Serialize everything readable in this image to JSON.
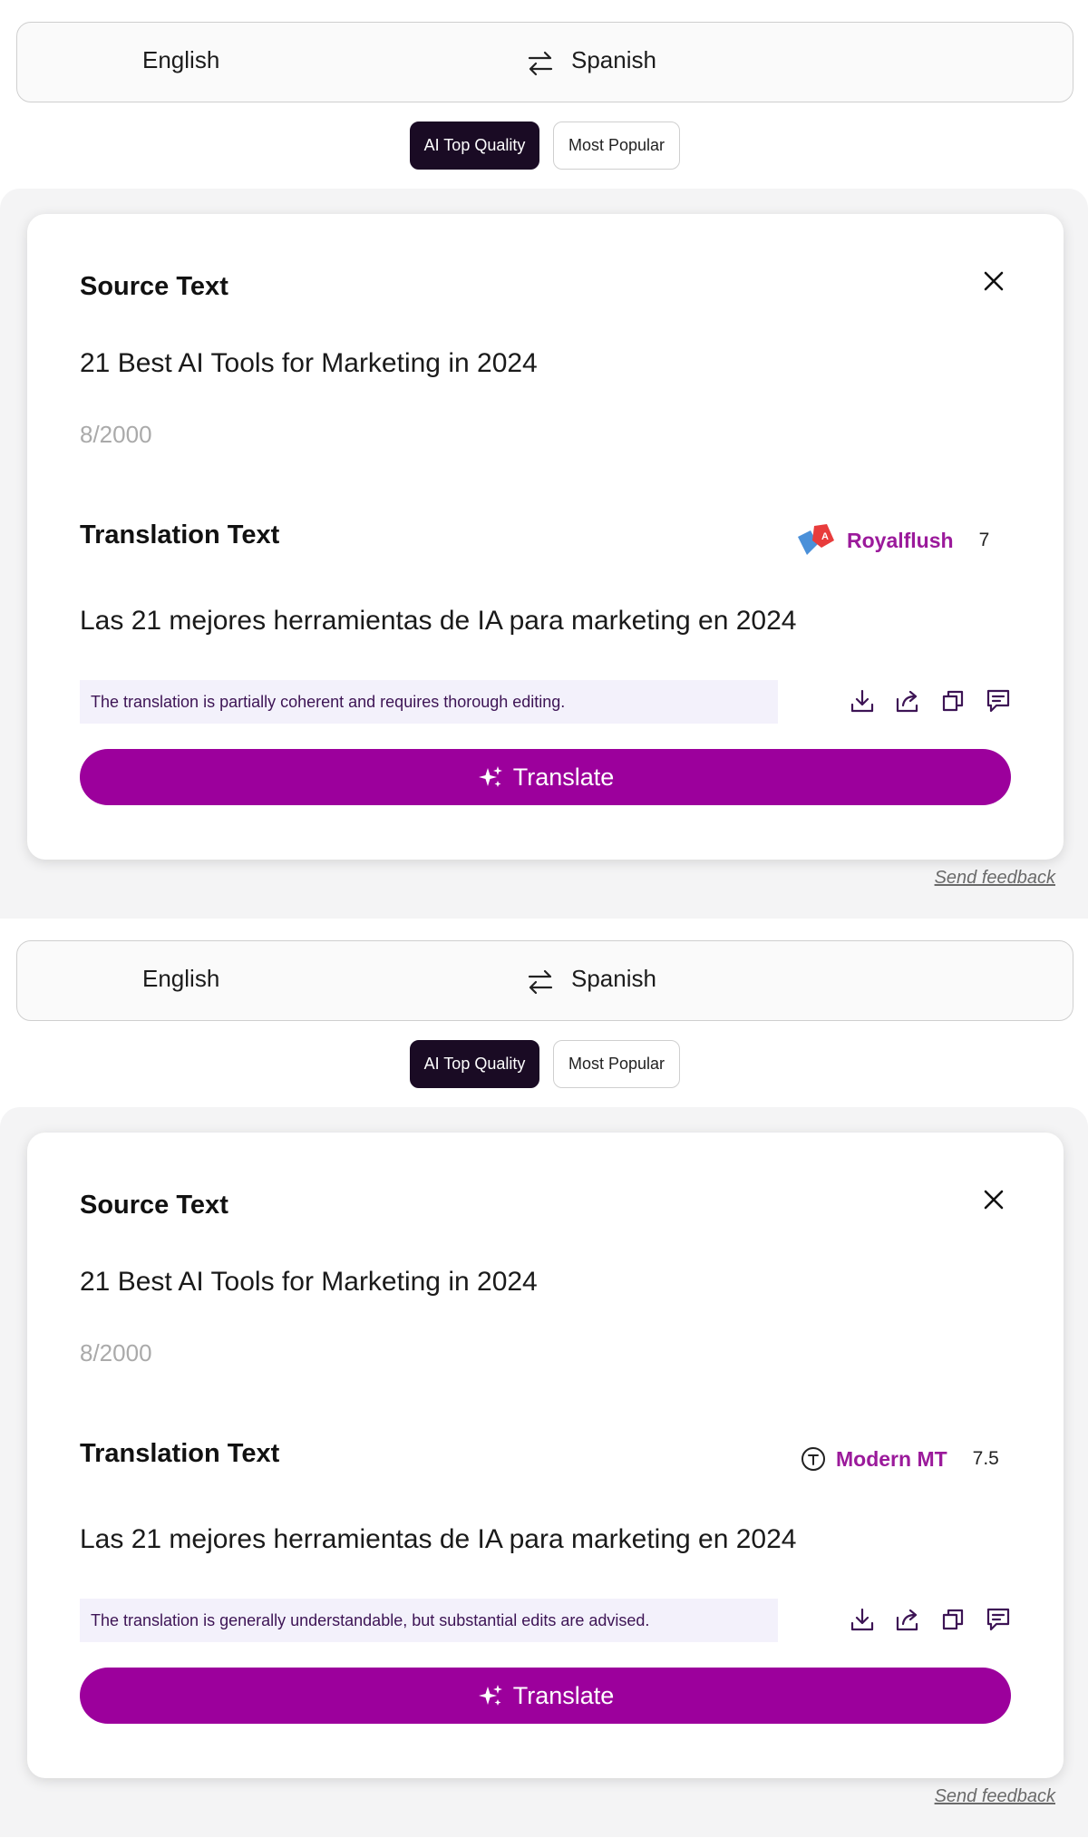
{
  "colors": {
    "accent": "#9c009c",
    "engine_name": "#9b1a9b",
    "active_mode_bg": "#1a0b24",
    "quality_bg": "#f3f1fb",
    "quality_text": "#3d1455"
  },
  "panels": [
    {
      "language": {
        "source": "English",
        "target": "Spanish",
        "swap_icon": "swap-arrows-icon"
      },
      "modes": {
        "active": "AI Top Quality",
        "inactive": "Most Popular"
      },
      "card": {
        "source_title": "Source Text",
        "source_text": "21 Best AI Tools for Marketing in 2024",
        "char_count": "8/2000",
        "translation_title": "Translation Text",
        "engine": {
          "name": "Royalflush",
          "score": "7",
          "logo": "royalflush-logo-icon"
        },
        "translation": "Las 21 mejores herramientas de IA para marketing en 2024",
        "quality_note": "The translation is partially coherent and requires thorough editing.",
        "translate_label": "Translate"
      },
      "feedback": "Send feedback"
    },
    {
      "language": {
        "source": "English",
        "target": "Spanish",
        "swap_icon": "swap-arrows-icon"
      },
      "modes": {
        "active": "AI Top Quality",
        "inactive": "Most Popular"
      },
      "card": {
        "source_title": "Source Text",
        "source_text": "21 Best AI Tools for Marketing in 2024",
        "char_count": "8/2000",
        "translation_title": "Translation Text",
        "engine": {
          "name": "Modern MT",
          "score": "7.5",
          "logo": "modernmt-logo-icon"
        },
        "translation": "Las 21 mejores herramientas de IA para marketing en 2024",
        "quality_note": "The translation is generally understandable, but substantial edits are advised.",
        "translate_label": "Translate"
      },
      "feedback": "Send feedback"
    }
  ]
}
